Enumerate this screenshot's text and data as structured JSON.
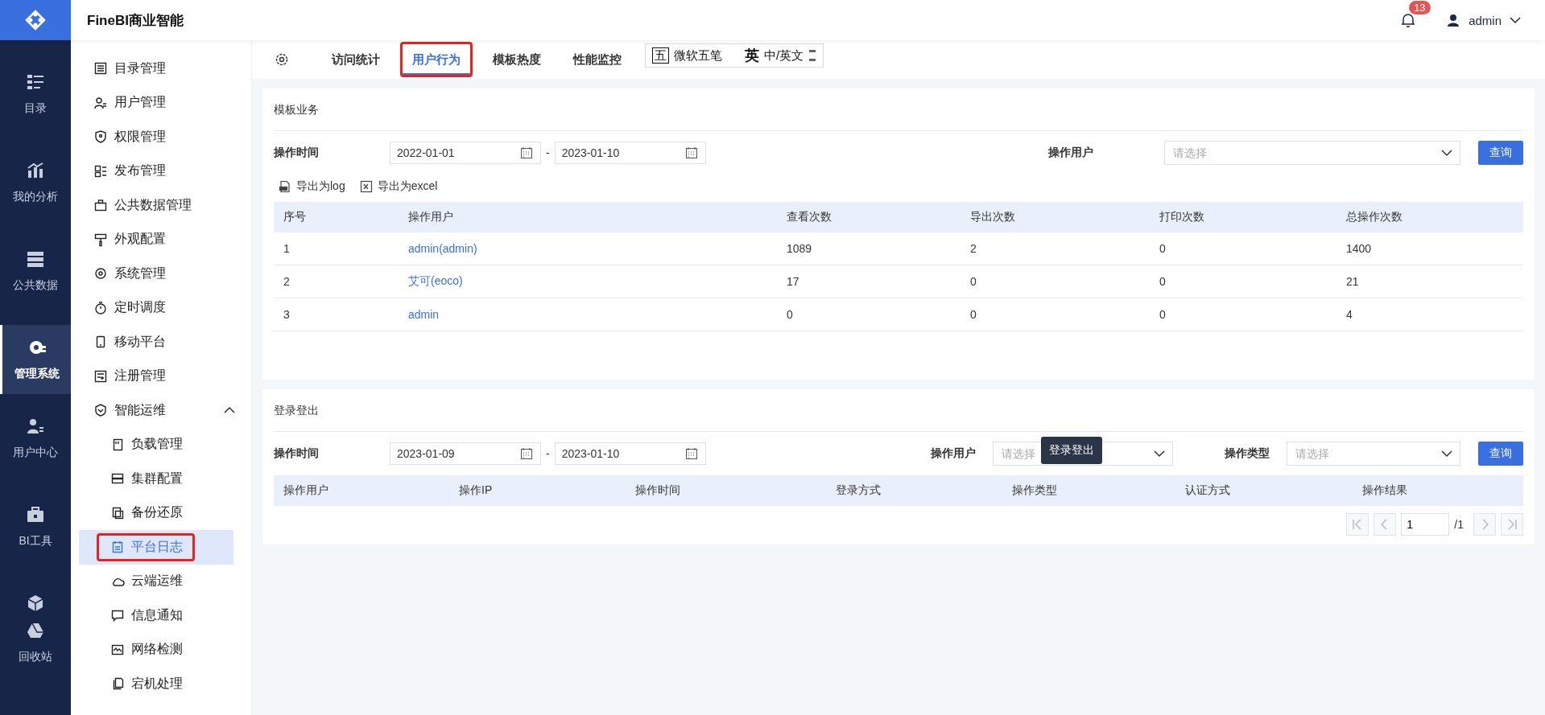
{
  "header": {
    "product": "FineBI商业智能",
    "notification_count": "13",
    "user": "admin"
  },
  "rail": [
    {
      "label": "目录",
      "selected": false
    },
    {
      "label": "我的分析",
      "selected": false
    },
    {
      "label": "公共数据",
      "selected": false
    },
    {
      "label": "管理系统",
      "selected": true
    },
    {
      "label": "用户中心",
      "selected": false
    },
    {
      "label": "BI工具",
      "selected": false
    },
    {
      "selected": false
    },
    {
      "label": "回收站",
      "selected": false
    }
  ],
  "menu": [
    {
      "label": "目录管理",
      "selected": false
    },
    {
      "label": "用户管理",
      "selected": false
    },
    {
      "label": "权限管理",
      "selected": false
    },
    {
      "label": "发布管理",
      "selected": false
    },
    {
      "label": "公共数据管理",
      "selected": false
    },
    {
      "label": "外观配置",
      "selected": false
    },
    {
      "label": "系统管理",
      "selected": false
    },
    {
      "label": "定时调度",
      "selected": false
    },
    {
      "label": "移动平台",
      "selected": false
    },
    {
      "label": "注册管理",
      "selected": false
    },
    {
      "label": "智能运维",
      "selected": false,
      "expanded": true,
      "children": [
        {
          "label": "负载管理",
          "selected": false,
          "outlined": false
        },
        {
          "label": "集群配置",
          "selected": false,
          "outlined": false
        },
        {
          "label": "备份还原",
          "selected": false,
          "outlined": false
        },
        {
          "label": "平台日志",
          "selected": true,
          "outlined": true
        },
        {
          "label": "云端运维",
          "selected": false,
          "outlined": false
        },
        {
          "label": "信息通知",
          "selected": false,
          "outlined": false
        },
        {
          "label": "网络检测",
          "selected": false,
          "outlined": false
        },
        {
          "label": "宕机处理",
          "selected": false,
          "outlined": false
        }
      ]
    }
  ],
  "tabs": [
    {
      "label": "访问统计",
      "selected": false,
      "outlined": false
    },
    {
      "label": "用户行为",
      "selected": true,
      "outlined": true
    },
    {
      "label": "模板热度",
      "selected": false,
      "outlined": false
    },
    {
      "label": "性能监控",
      "selected": false,
      "outlined": false
    }
  ],
  "ime_bar": {
    "mode_glyph": "五",
    "input_method": "微软五笔",
    "lang_glyph": "英",
    "toggle": "中/英文"
  },
  "template_section": {
    "title": "模板业务",
    "time_label": "操作时间",
    "date_from": "2022-01-01",
    "date_to": "2023-01-10",
    "separator": "-",
    "user_label": "操作用户",
    "user_placeholder": "请选择",
    "query_button": "查询",
    "exports": [
      "导出为log",
      "导出为excel"
    ],
    "table": {
      "columns": [
        {
          "label": "序号",
          "kind": "text"
        },
        {
          "label": "操作用户",
          "kind": "link"
        },
        {
          "label": "查看次数",
          "kind": "text"
        },
        {
          "label": "导出次数",
          "kind": "text"
        },
        {
          "label": "打印次数",
          "kind": "text"
        },
        {
          "label": "总操作次数",
          "kind": "text"
        }
      ],
      "rows": [
        [
          "1",
          "admin(admin)",
          "1089",
          "2",
          "0",
          "1400"
        ],
        [
          "2",
          "艾可(eoco)",
          "17",
          "0",
          "0",
          "21"
        ],
        [
          "3",
          "admin",
          "0",
          "0",
          "0",
          "4"
        ]
      ]
    }
  },
  "login_section": {
    "title": "登录登出",
    "time_label": "操作时间",
    "date_from": "2023-01-09",
    "date_to": "2023-01-10",
    "separator": "-",
    "user_label": "操作用户",
    "user_placeholder": "请选择",
    "type_label": "操作类型",
    "type_placeholder": "请选择",
    "query_button": "查询",
    "tooltip": "登录登出",
    "columns": [
      "操作用户",
      "操作IP",
      "操作时间",
      "登录方式",
      "操作类型",
      "认证方式",
      "操作结果"
    ],
    "pagination": {
      "page": "1",
      "total": "/1"
    }
  }
}
